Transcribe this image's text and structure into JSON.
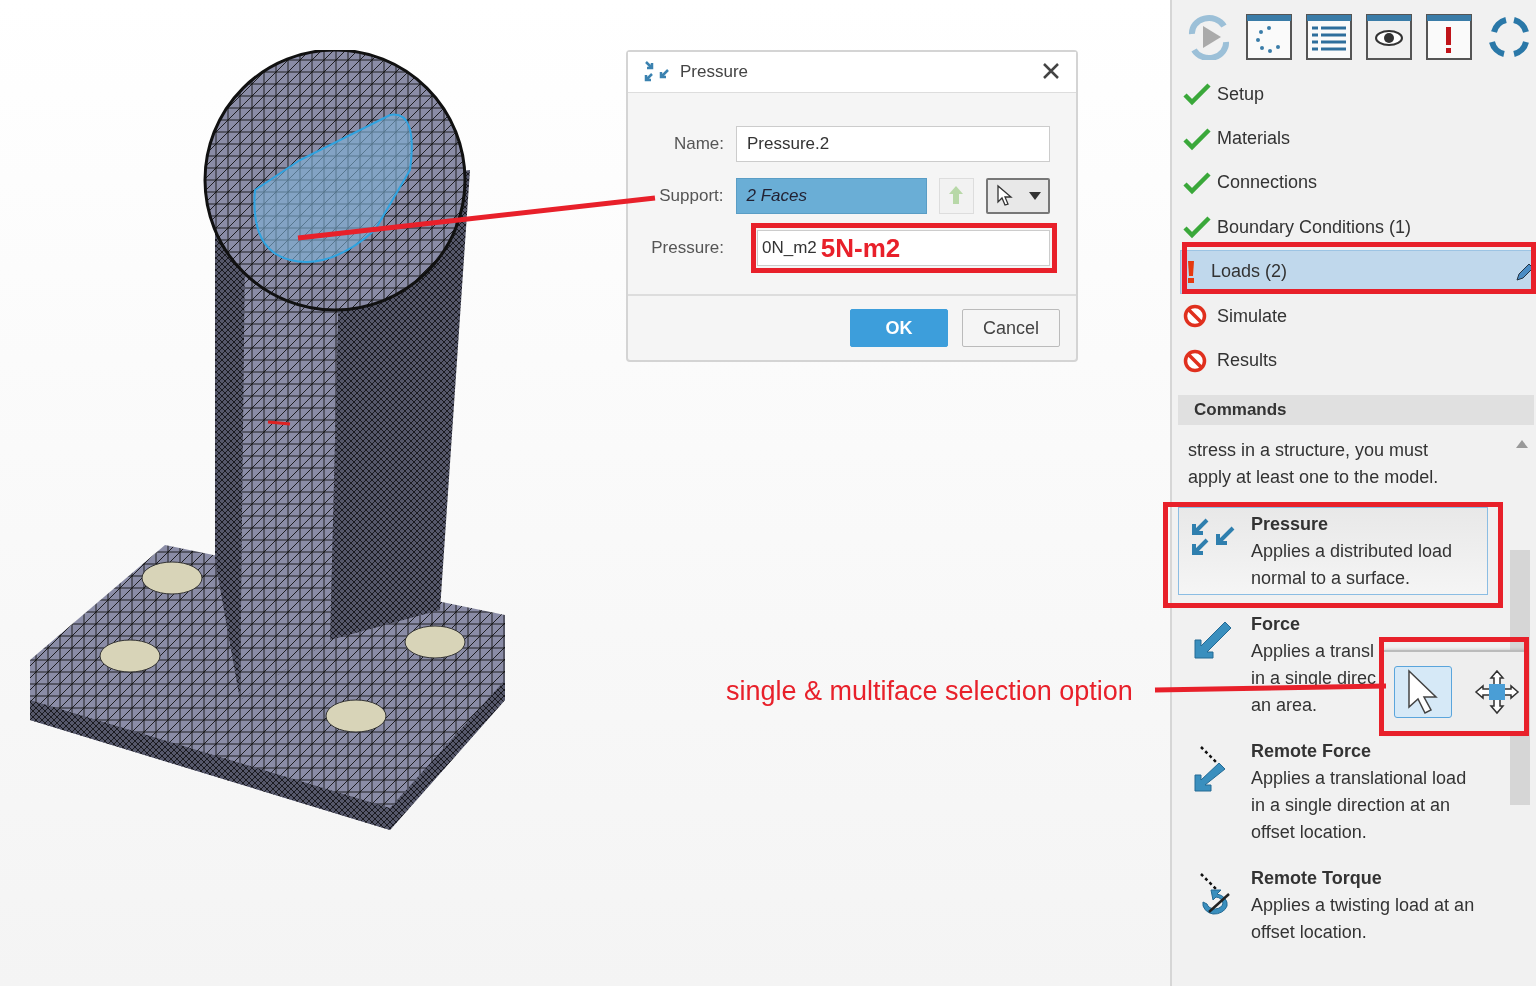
{
  "dialog": {
    "title": "Pressure",
    "fields": [
      {
        "kind": "text",
        "label": "Name:",
        "value": "Pressure.2"
      },
      {
        "kind": "selection",
        "label": "Support:",
        "value": "2 Faces"
      },
      {
        "kind": "annotated",
        "label": "Pressure:",
        "value": "0N_m2"
      }
    ],
    "buttons": [
      {
        "label": "OK",
        "kind": "primary"
      },
      {
        "label": "Cancel",
        "kind": "secondary"
      }
    ]
  },
  "workflow": {
    "steps": [
      {
        "label": "Setup",
        "kind": "done",
        "selected": false
      },
      {
        "label": "Materials",
        "kind": "done",
        "selected": false
      },
      {
        "label": "Connections",
        "kind": "done",
        "selected": false
      },
      {
        "label": "Boundary Conditions (1)",
        "kind": "done",
        "selected": false
      },
      {
        "label": "Loads (2)",
        "kind": "warning",
        "selected": true
      },
      {
        "label": "Simulate",
        "kind": "blocked",
        "selected": false
      },
      {
        "label": "Results",
        "kind": "blocked",
        "selected": false
      }
    ]
  },
  "commands": {
    "title": "Commands",
    "description_lines": [
      "stress in a structure, you must",
      "apply at least one to the model."
    ],
    "items": [
      {
        "kind": "pressure",
        "title": "Pressure",
        "description_lines": [
          "Applies a distributed load",
          "normal to a surface."
        ],
        "selected": true
      },
      {
        "kind": "force",
        "title": "Force",
        "description_lines": [
          "Applies a transl",
          "in a single direc",
          "an area."
        ],
        "selected": false
      },
      {
        "kind": "remote-force",
        "title": "Remote Force",
        "description_lines": [
          "Applies a translational load",
          "in a single direction at an",
          "offset location."
        ],
        "selected": false
      },
      {
        "kind": "remote-torque",
        "title": "Remote Torque",
        "description_lines": [
          "Applies a twisting load at an",
          "offset location."
        ],
        "selected": false
      }
    ]
  },
  "selection_popup": {
    "options": [
      {
        "kind": "single",
        "selected": true
      },
      {
        "kind": "multi",
        "selected": false
      }
    ]
  },
  "annotations": [
    {
      "kind": "value-note",
      "text": "5N-m2"
    },
    {
      "kind": "caption",
      "text": "single & multiface selection option"
    }
  ]
}
